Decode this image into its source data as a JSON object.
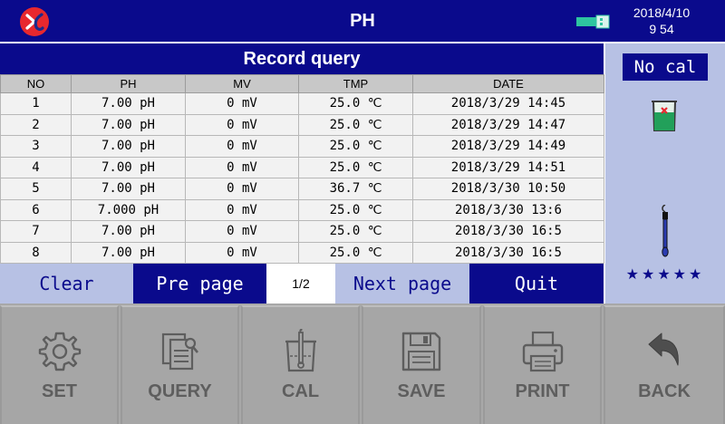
{
  "header": {
    "title": "PH",
    "date": "2018/4/10",
    "time": "9 54",
    "logo_icon": "logo-icon",
    "usb_icon": "usb-icon"
  },
  "records": {
    "title": "Record query",
    "columns": [
      "NO",
      "PH",
      "MV",
      "TMP",
      "DATE"
    ],
    "rows": [
      [
        "1",
        "7.00 pH",
        "0 mV",
        "25.0 ℃",
        "2018/3/29 14:45"
      ],
      [
        "2",
        "7.00 pH",
        "0 mV",
        "25.0 ℃",
        "2018/3/29 14:47"
      ],
      [
        "3",
        "7.00 pH",
        "0 mV",
        "25.0 ℃",
        "2018/3/29 14:49"
      ],
      [
        "4",
        "7.00 pH",
        "0 mV",
        "25.0 ℃",
        "2018/3/29 14:51"
      ],
      [
        "5",
        "7.00 pH",
        "0 mV",
        "36.7 ℃",
        "2018/3/30 10:50"
      ],
      [
        "6",
        "7.000 pH",
        "0 mV",
        "25.0 ℃",
        "2018/3/30 13:6"
      ],
      [
        "7",
        "7.00 pH",
        "0 mV",
        "25.0 ℃",
        "2018/3/30 16:5"
      ],
      [
        "8",
        "7.00 pH",
        "0 mV",
        "25.0 ℃",
        "2018/3/30 16:5"
      ]
    ]
  },
  "actions": {
    "clear": "Clear",
    "pre_page": "Pre page",
    "page_indicator": "1/2",
    "next_page": "Next page",
    "quit": "Quit"
  },
  "side": {
    "cal_status": "No cal",
    "stars": "★★★★★",
    "beaker_icon": "beaker-icon",
    "probe_icon": "electrode-probe-icon"
  },
  "functions": [
    {
      "label": "SET",
      "icon": "gear-icon"
    },
    {
      "label": "QUERY",
      "icon": "document-search-icon"
    },
    {
      "label": "CAL",
      "icon": "beaker-probe-icon"
    },
    {
      "label": "SAVE",
      "icon": "floppy-disk-icon"
    },
    {
      "label": "PRINT",
      "icon": "printer-icon"
    },
    {
      "label": "BACK",
      "icon": "back-arrow-icon"
    }
  ],
  "colors": {
    "primary": "#0a0a8c",
    "light_panel": "#b7c1e4",
    "function_bar": "#a6a6a6",
    "logo_red": "#e8282e",
    "usb_teal": "#2ec4a0"
  }
}
